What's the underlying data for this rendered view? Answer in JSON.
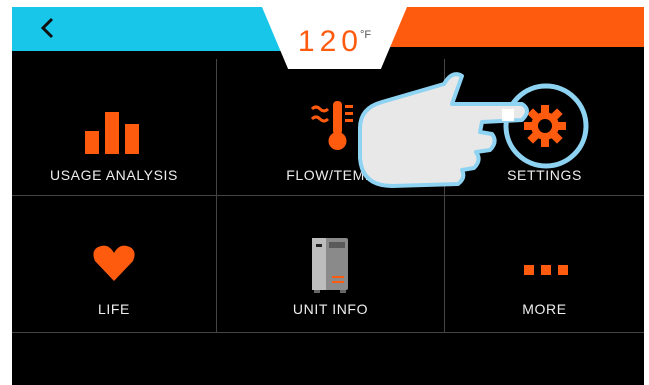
{
  "header": {
    "temperature_value": "120",
    "temperature_unit": "°F",
    "back_icon": "chevron-left-icon",
    "colors": {
      "left_bar": "#18c6ea",
      "right_bar": "#ff5b0f",
      "accent": "#ff5b0f"
    }
  },
  "menu": {
    "items": [
      {
        "label": "USAGE ANALYSIS",
        "icon": "bar-chart-icon"
      },
      {
        "label": "FLOW/TEMP",
        "icon": "flow-temp-icon"
      },
      {
        "label": "SETTINGS",
        "icon": "gear-icon"
      },
      {
        "label": "LIFE",
        "icon": "heart-icon"
      },
      {
        "label": "UNIT INFO",
        "icon": "water-heater-unit-icon"
      },
      {
        "label": "MORE",
        "icon": "more-dots-icon"
      }
    ]
  },
  "overlay": {
    "icon": "pointing-hand-icon",
    "highlight": "settings"
  }
}
